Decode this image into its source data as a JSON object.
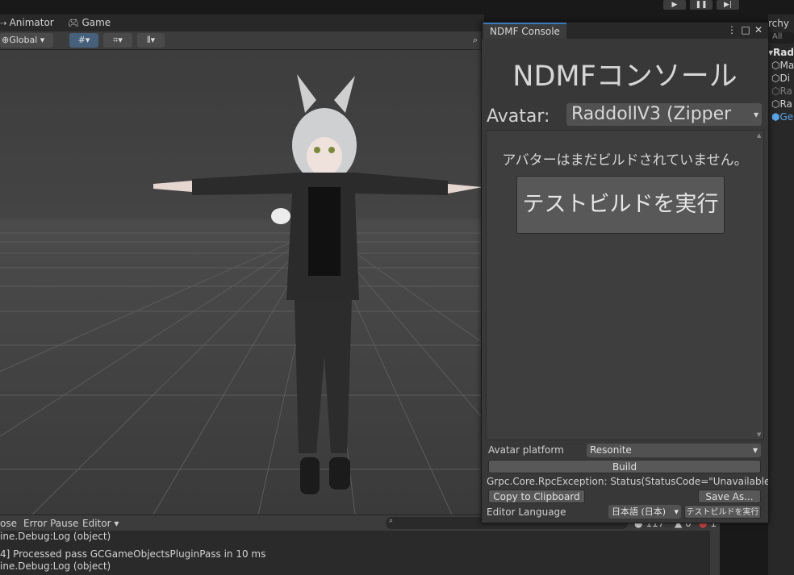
{
  "topbar": {
    "play_icon": "play-icon",
    "pause_icon": "pause-icon",
    "step_icon": "step-icon"
  },
  "tabs": {
    "animator": "Animator",
    "game": "Game"
  },
  "scene_toolbar": {
    "pivot_mode": "Global",
    "grid_label": ""
  },
  "console": {
    "toolbar": {
      "collapse": "ose",
      "error_pause": "Error Pause",
      "editor": "Editor",
      "count_info": "117",
      "count_warn": "0",
      "count_err": "1"
    },
    "lines": [
      "ine.Debug:Log (object)",
      "4] Processed pass GCGameObjectsPluginPass in 10 ms",
      "ine.Debug:Log (object)"
    ]
  },
  "hierarchy": {
    "title": "rchy",
    "search_placeholder": "All",
    "items": [
      "Radl",
      "Ma",
      "Di",
      "Ra",
      "Ra",
      "Ge"
    ]
  },
  "ndmf": {
    "tab_label": "NDMF Console",
    "title": "NDMFコンソール",
    "avatar_label": "Avatar:",
    "avatar_value": "RaddollV3 (Zipper",
    "not_built_message": "アバターはまだビルドされていません。",
    "test_build_button": "テストビルドを実行",
    "platform_label": "Avatar platform",
    "platform_value": "Resonite",
    "build_button": "Build",
    "status_text": "Grpc.Core.RpcException: Status(StatusCode=\"Unavailable",
    "copy_button": "Copy to Clipboard",
    "save_button": "Save As...",
    "language_label": "Editor Language",
    "language_value": "日本語 (日本)",
    "small_test_build_button": "テストビルドを実行"
  },
  "colors": {
    "accent": "#3a79bb",
    "window_bg": "#383838",
    "panel_bg": "#282828"
  }
}
